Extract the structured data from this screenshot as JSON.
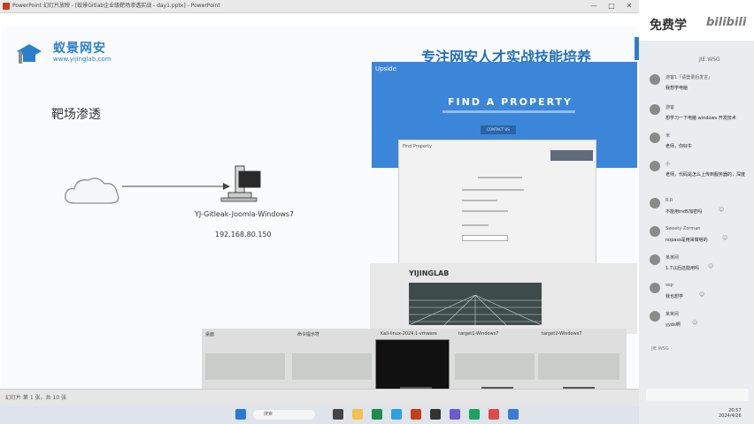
{
  "window": {
    "title": "PowerPoint 幻灯片放映 - [蚁景Gitlab企业级靶场渗透实战 - day1.pptx] - PowerPoint",
    "min": "—",
    "max": "□",
    "close": "✕"
  },
  "slide": {
    "logo_cn": "蚁景网安",
    "logo_url": "www.yijinglab.com",
    "slogan": "专注网安人才实战技能培养",
    "heading": "靶场渗透",
    "host_label": "YJ-Gitleak-Joomla-Windows7",
    "host_ip": "192.168.80.150"
  },
  "statusbar": {
    "text": "幻灯片 第 1 张，共 10 张"
  },
  "overlay": {
    "site_brand": "Upside",
    "find_title": "FIND A PROPERTY",
    "find_button": "CONTACT US",
    "panel_title": "Find Property",
    "vm_logo": "YIJINGLAB"
  },
  "switcher": {
    "tabs": [
      {
        "label": "桌面"
      },
      {
        "label": "命令提示符"
      },
      {
        "label": "Kali-linux-2024.1-vmware"
      },
      {
        "label": "target1-Windows7"
      },
      {
        "label": "target2-Windows7"
      }
    ]
  },
  "taskbar": {
    "search_placeholder": "搜索",
    "time": "20:57",
    "date": "2024/4/26"
  },
  "chat": {
    "brand": "免费学",
    "logo": "bilibili",
    "header": "JIE.WSG",
    "footer": "JIE.WSG",
    "messages": [
      {
        "name": "游客1「请登录后发言」",
        "text": "我想学电脑"
      },
      {
        "name": "游客",
        "text": "想学习一下电脑 windows 开发技术"
      },
      {
        "name": "米",
        "text": "老师，你好牛"
      },
      {
        "name": "小",
        "text": "老师，代码是怎么上传到服务器的，深度"
      },
      {
        "name": "R.R",
        "text": "不能用md5加密吗"
      },
      {
        "name": "Sweety Zorman",
        "text": "nopass是用来做啥的"
      },
      {
        "name": "某某网",
        "text": "1.7以后还能用吗"
      },
      {
        "name": "wqr",
        "text": "我也想学"
      },
      {
        "name": "某某网",
        "text": "yyds啊"
      }
    ]
  },
  "colors": {
    "brand_blue": "#2a7fcb",
    "web_blue": "#3b86d8"
  }
}
